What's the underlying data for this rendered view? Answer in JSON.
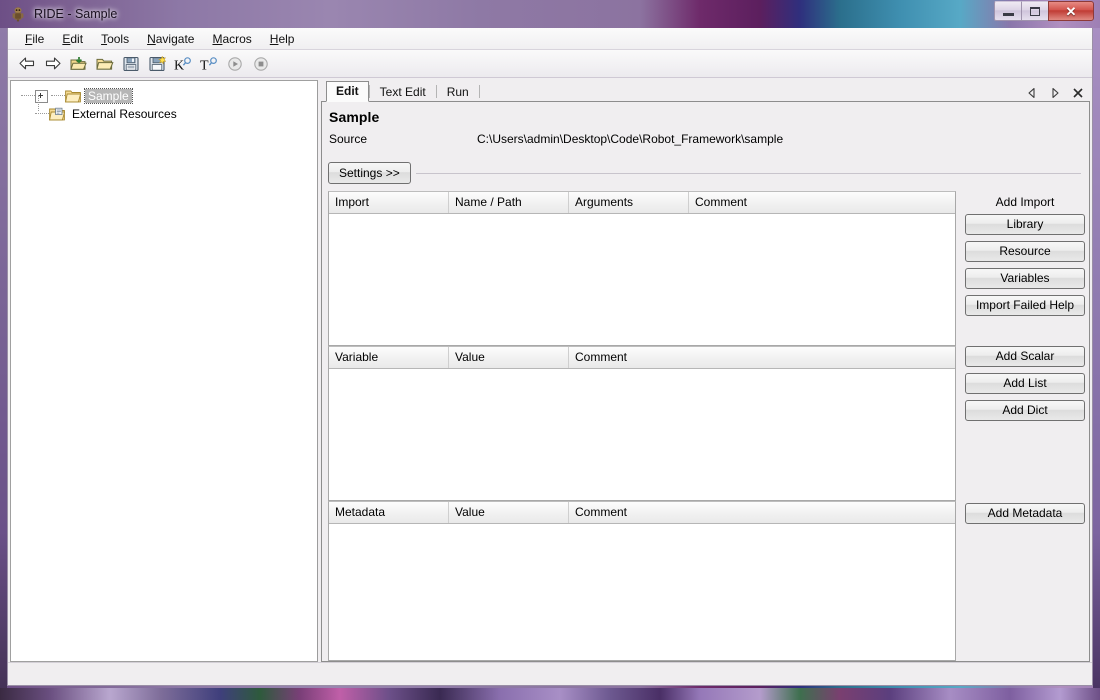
{
  "window": {
    "title": "RIDE - Sample",
    "app_icon": "robot-icon",
    "controls": {
      "minimize": "minimize-button",
      "maximize": "maximize-button",
      "close": "✕"
    }
  },
  "menubar": {
    "items": [
      {
        "label": "File",
        "mnemonic": "F"
      },
      {
        "label": "Edit",
        "mnemonic": "E"
      },
      {
        "label": "Tools",
        "mnemonic": "T"
      },
      {
        "label": "Navigate",
        "mnemonic": "N"
      },
      {
        "label": "Macros",
        "mnemonic": "M"
      },
      {
        "label": "Help",
        "mnemonic": "H"
      }
    ]
  },
  "toolbar": {
    "buttons": [
      {
        "name": "back-arrow-icon",
        "title": "Go Back"
      },
      {
        "name": "forward-arrow-icon",
        "title": "Go Forward"
      },
      {
        "name": "open-folder-new-icon",
        "title": "Open Directory"
      },
      {
        "name": "open-folder-icon",
        "title": "Open"
      },
      {
        "name": "save-icon",
        "title": "Save"
      },
      {
        "name": "save-all-icon",
        "title": "Save All"
      },
      {
        "name": "search-keyword-icon",
        "title": "Search Keywords"
      },
      {
        "name": "search-tests-icon",
        "title": "Search Tests"
      },
      {
        "name": "run-icon",
        "title": "Run"
      },
      {
        "name": "stop-icon",
        "title": "Stop"
      }
    ]
  },
  "tree": {
    "nodes": [
      {
        "label": "Sample",
        "icon": "folder-icon",
        "selected": true,
        "expandable": true
      },
      {
        "label": "External Resources",
        "icon": "resource-folder-icon",
        "selected": false,
        "expandable": false
      }
    ]
  },
  "editor": {
    "tabs": [
      {
        "label": "Edit",
        "active": true
      },
      {
        "label": "Text Edit",
        "active": false
      },
      {
        "label": "Run",
        "active": false
      }
    ],
    "tab_nav": {
      "prev": "◁",
      "next": "▷",
      "close": "✕"
    },
    "title": "Sample",
    "source_label": "Source",
    "source_value": "C:\\Users\\admin\\Desktop\\Code\\Robot_Framework\\sample",
    "settings_button": "Settings >>",
    "sections": [
      {
        "name": "import",
        "columns": [
          "Import",
          "Name / Path",
          "Arguments",
          "Comment"
        ],
        "rows": [],
        "side_title": "Add Import",
        "side_buttons": [
          "Library",
          "Resource",
          "Variables",
          "Import Failed Help"
        ]
      },
      {
        "name": "variable",
        "columns": [
          "Variable",
          "Value",
          "Comment"
        ],
        "rows": [],
        "side_title": "",
        "side_buttons": [
          "Add Scalar",
          "Add List",
          "Add Dict"
        ]
      },
      {
        "name": "metadata",
        "columns": [
          "Metadata",
          "Value",
          "Comment"
        ],
        "rows": [],
        "side_title": "",
        "side_buttons": [
          "Add Metadata"
        ]
      }
    ]
  },
  "statusbar": {
    "text": ""
  },
  "colors": {
    "window_frame": "#8f7ba8",
    "client_bg": "#f0eef0",
    "grid_bg": "#ffffff",
    "selection": "#b6b6b6",
    "close_button": "#c4433c"
  }
}
